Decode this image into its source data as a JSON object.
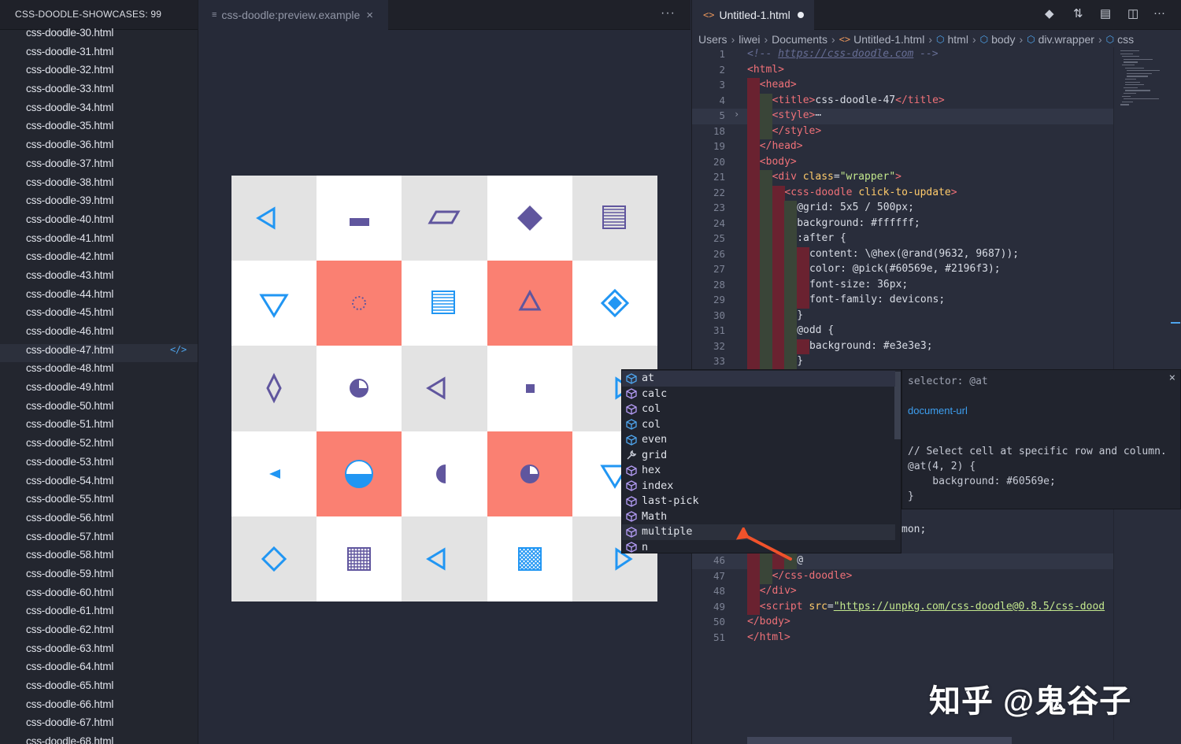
{
  "sidebar": {
    "header": "CSS-DOODLE-SHOWCASES: 99",
    "active_badge": "</>",
    "files": [
      "css-doodle-30.html",
      "css-doodle-31.html",
      "css-doodle-32.html",
      "css-doodle-33.html",
      "css-doodle-34.html",
      "css-doodle-35.html",
      "css-doodle-36.html",
      "css-doodle-37.html",
      "css-doodle-38.html",
      "css-doodle-39.html",
      "css-doodle-40.html",
      "css-doodle-41.html",
      "css-doodle-42.html",
      "css-doodle-43.html",
      "css-doodle-44.html",
      "css-doodle-45.html",
      "css-doodle-46.html",
      "css-doodle-47.html",
      "css-doodle-48.html",
      "css-doodle-49.html",
      "css-doodle-50.html",
      "css-doodle-51.html",
      "css-doodle-52.html",
      "css-doodle-53.html",
      "css-doodle-54.html",
      "css-doodle-55.html",
      "css-doodle-56.html",
      "css-doodle-57.html",
      "css-doodle-58.html",
      "css-doodle-59.html",
      "css-doodle-60.html",
      "css-doodle-61.html",
      "css-doodle-62.html",
      "css-doodle-63.html",
      "css-doodle-64.html",
      "css-doodle-65.html",
      "css-doodle-66.html",
      "css-doodle-67.html",
      "css-doodle-68.html"
    ],
    "active_file": "css-doodle-47.html"
  },
  "preview_tab": {
    "icon": "≡",
    "label": "css-doodle:preview.example",
    "close": "×",
    "more": "···"
  },
  "doodle": {
    "colors": {
      "cell_gray": "#e3e3e3",
      "cell_white": "#ffffff",
      "cell_salmon": "#fa8072",
      "purple": "#60569e",
      "blue": "#2196f3"
    },
    "cells": [
      [
        "#e3e3e3",
        "tri-left-outline",
        "#2196f3"
      ],
      [
        "#ffffff",
        "rect-solid",
        "#60569e"
      ],
      [
        "#e3e3e3",
        "parallelogram-outline",
        "#60569e"
      ],
      [
        "#ffffff",
        "diamond-solid",
        "#60569e"
      ],
      [
        "#e3e3e3",
        "square-lines",
        "#60569e"
      ],
      [
        "#ffffff",
        "tri-down-outline",
        "#2196f3"
      ],
      [
        "#fa8072",
        "dotted-circle",
        "#60569e"
      ],
      [
        "#ffffff",
        "square-lines",
        "#2196f3"
      ],
      [
        "#fa8072",
        "tri-up-outline",
        "#60569e"
      ],
      [
        "#ffffff",
        "diamond-dot",
        "#2196f3"
      ],
      [
        "#e3e3e3",
        "lozenge-outline",
        "#60569e"
      ],
      [
        "#ffffff",
        "circle-quarter",
        "#60569e"
      ],
      [
        "#e3e3e3",
        "tri-left-outline",
        "#60569e"
      ],
      [
        "#ffffff",
        "small-square",
        "#60569e"
      ],
      [
        "#e3e3e3",
        "tri-right-outline",
        "#2196f3"
      ],
      [
        "#ffffff",
        "tri-left-solid",
        "#2196f3"
      ],
      [
        "#fa8072",
        "circle-half-bottom",
        "#2196f3"
      ],
      [
        "#ffffff",
        "circle-half-left",
        "#60569e"
      ],
      [
        "#fa8072",
        "circle-quarter",
        "#60569e"
      ],
      [
        "#ffffff",
        "tri-down-outline",
        "#2196f3"
      ],
      [
        "#e3e3e3",
        "diamond-outline",
        "#2196f3"
      ],
      [
        "#ffffff",
        "square-grid",
        "#60569e"
      ],
      [
        "#e3e3e3",
        "tri-left-outline",
        "#2196f3"
      ],
      [
        "#ffffff",
        "square-crosshatch",
        "#2196f3"
      ],
      [
        "#e3e3e3",
        "tri-right-outline",
        "#2196f3"
      ]
    ]
  },
  "editor": {
    "tab_icon": "<>",
    "tab_label": "Untitled-1.html",
    "toolbar_icons": [
      "git-icon",
      "compare-icon",
      "open-preview-icon",
      "split-editor-icon",
      "more-icon"
    ],
    "toolbar_glyphs": [
      "◆",
      "⇅",
      "▤",
      "◫",
      "···"
    ],
    "breadcrumb": [
      {
        "label": "Users",
        "icon": ""
      },
      {
        "label": "liwei",
        "icon": ""
      },
      {
        "label": "Documents",
        "icon": ""
      },
      {
        "label": "Untitled-1.html",
        "icon": "<>"
      },
      {
        "label": "html",
        "icon": "⬡"
      },
      {
        "label": "body",
        "icon": "⬡"
      },
      {
        "label": "div.wrapper",
        "icon": "⬡"
      },
      {
        "label": "css",
        "icon": "⬡"
      }
    ],
    "lines": [
      {
        "n": "1",
        "g": [],
        "t": [
          [
            "comment",
            "<!-- "
          ],
          [
            "comment url",
            "https://css-doodle.com"
          ],
          [
            "comment",
            " -->"
          ]
        ]
      },
      {
        "n": "2",
        "g": [],
        "t": [
          [
            "tag",
            "<html>"
          ]
        ]
      },
      {
        "n": "3",
        "g": [
          "red"
        ],
        "t": [
          [
            "tag",
            "<head>"
          ]
        ]
      },
      {
        "n": "4",
        "g": [
          "red",
          "olive"
        ],
        "t": [
          [
            "tag",
            "<title>"
          ],
          [
            "",
            "css-doodle-47"
          ],
          [
            "tag",
            "</title>"
          ]
        ]
      },
      {
        "n": "5",
        "g": [
          "red",
          "olive"
        ],
        "fold": "›",
        "hl": true,
        "t": [
          [
            "tag",
            "<style>"
          ],
          [
            "",
            "⋯"
          ]
        ]
      },
      {
        "n": "18",
        "g": [
          "red",
          "olive"
        ],
        "t": [
          [
            "tag",
            "</style>"
          ]
        ]
      },
      {
        "n": "19",
        "g": [
          "red"
        ],
        "t": [
          [
            "tag",
            "</head>"
          ]
        ]
      },
      {
        "n": "20",
        "g": [
          "red"
        ],
        "t": [
          [
            "tag",
            "<body>"
          ]
        ]
      },
      {
        "n": "21",
        "g": [
          "red",
          "olive"
        ],
        "t": [
          [
            "tag",
            "<div "
          ],
          [
            "attr",
            "class"
          ],
          [
            "",
            "="
          ],
          [
            "str",
            "\"wrapper\""
          ],
          [
            "tag",
            ">"
          ]
        ]
      },
      {
        "n": "22",
        "g": [
          "red",
          "olive",
          "red"
        ],
        "t": [
          [
            "tag",
            "<css-doodle "
          ],
          [
            "attr",
            "click-to-update"
          ],
          [
            "tag",
            ">"
          ]
        ]
      },
      {
        "n": "23",
        "g": [
          "red",
          "olive",
          "red",
          "olive"
        ],
        "t": [
          [
            "",
            "@grid: 5x5 / 500px;"
          ]
        ]
      },
      {
        "n": "24",
        "g": [
          "red",
          "olive",
          "red",
          "olive"
        ],
        "t": [
          [
            "",
            "background: #ffffff;"
          ]
        ]
      },
      {
        "n": "25",
        "g": [
          "red",
          "olive",
          "red",
          "olive"
        ],
        "t": [
          [
            "",
            ":after {"
          ]
        ]
      },
      {
        "n": "26",
        "g": [
          "red",
          "olive",
          "red",
          "olive",
          "red"
        ],
        "t": [
          [
            "",
            "content: \\@hex(@rand(9632, 9687));"
          ]
        ]
      },
      {
        "n": "27",
        "g": [
          "red",
          "olive",
          "red",
          "olive",
          "red"
        ],
        "t": [
          [
            "",
            "color: @pick(#60569e, #2196f3);"
          ]
        ]
      },
      {
        "n": "28",
        "g": [
          "red",
          "olive",
          "red",
          "olive",
          "red"
        ],
        "t": [
          [
            "",
            "font-size: 36px;"
          ]
        ]
      },
      {
        "n": "29",
        "g": [
          "red",
          "olive",
          "red",
          "olive",
          "red"
        ],
        "t": [
          [
            "",
            "font-family: devicons;"
          ]
        ]
      },
      {
        "n": "30",
        "g": [
          "red",
          "olive",
          "red",
          "olive"
        ],
        "t": [
          [
            "",
            "}"
          ]
        ]
      },
      {
        "n": "31",
        "g": [
          "red",
          "olive",
          "red",
          "olive"
        ],
        "t": [
          [
            "",
            "@odd {"
          ]
        ]
      },
      {
        "n": "32",
        "g": [
          "red",
          "olive",
          "red",
          "olive",
          "red"
        ],
        "t": [
          [
            "",
            "background: #e3e3e3;"
          ]
        ]
      },
      {
        "n": "33",
        "g": [
          "red",
          "olive",
          "red",
          "olive"
        ],
        "t": [
          [
            "",
            "}"
          ]
        ]
      }
    ],
    "lines_bottom": [
      {
        "n": "46",
        "g": [
          "red",
          "olive",
          "red",
          "olive"
        ],
        "hl": true,
        "t": [
          [
            "",
            "@"
          ]
        ]
      },
      {
        "n": "47",
        "g": [
          "red",
          "olive"
        ],
        "t": [
          [
            "tag",
            "</css-doodle>"
          ]
        ]
      },
      {
        "n": "48",
        "g": [
          "red"
        ],
        "t": [
          [
            "tag",
            "</div>"
          ]
        ]
      },
      {
        "n": "49",
        "g": [
          "red"
        ],
        "t": [
          [
            "tag",
            "<script "
          ],
          [
            "attr",
            "src"
          ],
          [
            "",
            "="
          ],
          [
            "str url",
            "\"https://unpkg.com/css-doodle@0.8.5/css-dood"
          ]
        ]
      },
      {
        "n": "50",
        "g": [],
        "t": [
          [
            "tag",
            "</body>"
          ]
        ]
      },
      {
        "n": "51",
        "g": [],
        "t": [
          [
            "tag",
            "</html>"
          ]
        ]
      }
    ],
    "hidden_tail": "mon;"
  },
  "suggest": {
    "items": [
      {
        "label": "at",
        "kind": "module"
      },
      {
        "label": "calc",
        "kind": "box"
      },
      {
        "label": "col",
        "kind": "box"
      },
      {
        "label": "col",
        "kind": "module"
      },
      {
        "label": "even",
        "kind": "module"
      },
      {
        "label": "grid",
        "kind": "wrench"
      },
      {
        "label": "hex",
        "kind": "box"
      },
      {
        "label": "index",
        "kind": "box"
      },
      {
        "label": "last-pick",
        "kind": "box"
      },
      {
        "label": "Math",
        "kind": "box"
      },
      {
        "label": "multiple",
        "kind": "box"
      },
      {
        "label": "n",
        "kind": "box"
      }
    ],
    "selected_index": 0,
    "hover_index": 10,
    "icon_colors": {
      "module": "#4ea4ec",
      "box": "#b49cf5",
      "wrench": "#c7cbd6"
    }
  },
  "detail": {
    "selector": "selector: @at",
    "link": "document-url",
    "code": [
      "// Select cell at specific row and column.",
      "@at(4, 2) {",
      "    background: #60569e;",
      "}"
    ],
    "close": "×"
  },
  "annotation": {
    "arrow_color": "#f0522b"
  },
  "watermark": "知乎 @鬼谷子"
}
